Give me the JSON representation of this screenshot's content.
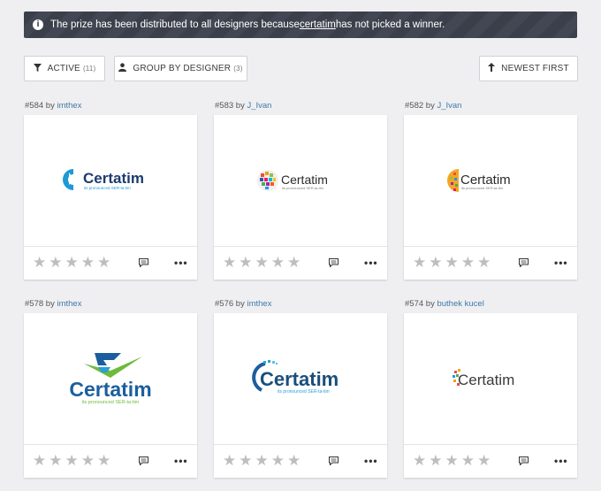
{
  "banner": {
    "text_before": "The prize has been distributed to all designers because ",
    "link_text": "certatim",
    "text_after": " has not picked a winner."
  },
  "toolbar": {
    "active_label": "ACTIVE",
    "active_count": "(11)",
    "group_label": "GROUP BY DESIGNER",
    "group_count": "(3)",
    "sort_label": "NEWEST FIRST"
  },
  "entries": [
    {
      "id": "#584",
      "by": "by",
      "user": "imthex",
      "logo_text": "Certatim",
      "tagline": "its pronounced SER-ta-tim"
    },
    {
      "id": "#583",
      "by": "by",
      "user": "J_Ivan",
      "logo_text": "Certatim",
      "tagline": "its pronounced SER-ta-tim"
    },
    {
      "id": "#582",
      "by": "by",
      "user": "J_Ivan",
      "logo_text": "Certatim",
      "tagline": "its pronounced SER-ta-tim"
    },
    {
      "id": "#578",
      "by": "by",
      "user": "imthex",
      "logo_text": "Certatim",
      "tagline": "its pronounced SER-ta-tim"
    },
    {
      "id": "#576",
      "by": "by",
      "user": "imthex",
      "logo_text": "Certatim",
      "tagline": "its pronounced SER-ta-tim"
    },
    {
      "id": "#574",
      "by": "by",
      "user": "buthek kucel",
      "logo_text": "Certatim",
      "tagline": ""
    }
  ],
  "colors": {
    "banner_bg": "#3a3f4a",
    "link_blue": "#3f79a8",
    "star_gray": "#bdbdc2"
  }
}
